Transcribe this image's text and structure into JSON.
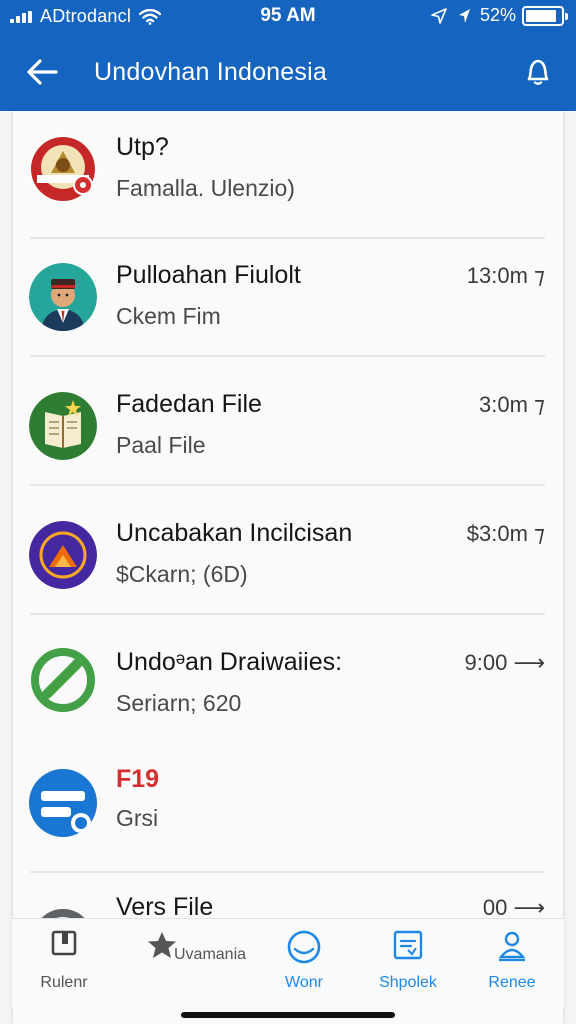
{
  "status_bar": {
    "carrier": "ADtrodancl",
    "time": "95 AM",
    "battery": "52%"
  },
  "app_bar": {
    "title": "Undovhan Indonesia",
    "back_icon": "arrow-left-icon",
    "action_icon": "bell-icon"
  },
  "colors": {
    "header": "#1565c0",
    "accent": "#1e88e5",
    "red": "#d32f2f"
  },
  "conversations": [
    {
      "title": "Utp?",
      "subtitle": "Famalla. Ulenzio)",
      "time": ""
    },
    {
      "title": "Pulloahan Fiulolt",
      "subtitle": "Ckem Fim",
      "time": "13:0m ⁊"
    },
    {
      "title": "Fadedan File",
      "subtitle": "Paal File",
      "time": "3:0m ⁊"
    },
    {
      "title": "Uncabakan Incilcisan",
      "subtitle": "$Ckarn; (6D)",
      "time": "$3:0m ⁊"
    },
    {
      "title": "Undoᵊan Draiwaiies:",
      "subtitle": "Seriarn; 620",
      "time": "9:00 ⟶"
    },
    {
      "title": "F19",
      "subtitle": "Grsi",
      "time": ""
    },
    {
      "title": "Vers File",
      "subtitle": "",
      "time": "00 ⟶"
    }
  ],
  "bottom_nav": [
    {
      "label": "Rulenr",
      "icon": "bookmark-icon"
    },
    {
      "label": "Uvamania",
      "icon": "star-house-icon"
    },
    {
      "label": "Wonr",
      "icon": "circle-wave-icon"
    },
    {
      "label": "Shpolek",
      "icon": "document-icon"
    },
    {
      "label": "Renee",
      "icon": "person-icon"
    }
  ]
}
